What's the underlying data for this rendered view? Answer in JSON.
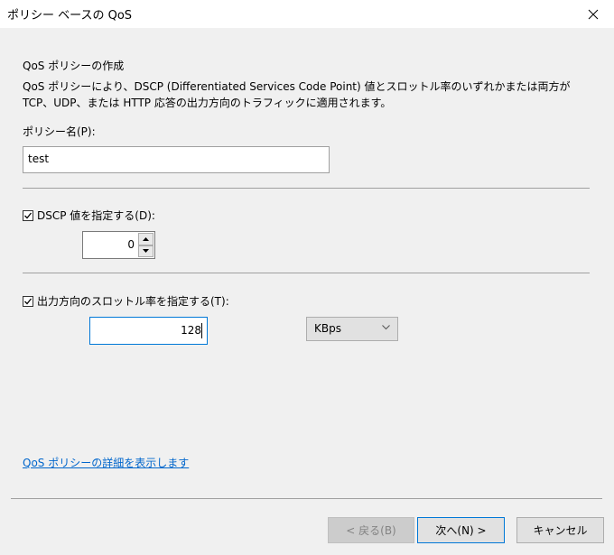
{
  "window": {
    "title": "ポリシー ベースの QoS"
  },
  "page": {
    "heading": "QoS ポリシーの作成",
    "description": "QoS ポリシーにより、DSCP (Differentiated Services Code Point) 値とスロットル率のいずれかまたは両方が TCP、UDP、または HTTP 応答の出力方向のトラフィックに適用されます。",
    "policy_name_label": "ポリシー名(P):",
    "policy_name_value": "test",
    "dscp": {
      "label": "DSCP 値を指定する(D):",
      "checked": true,
      "value": "0"
    },
    "throttle": {
      "label": "出力方向のスロットル率を指定する(T):",
      "checked": true,
      "value": "128",
      "unit": "KBps"
    },
    "details_link": "QoS ポリシーの詳細を表示します"
  },
  "buttons": {
    "back": "< 戻る(B)",
    "next": "次へ(N) >",
    "cancel": "キャンセル"
  },
  "icons": {
    "close": "close-icon",
    "checkbox": "checkmark-icon",
    "spin_up": "arrow-up-icon",
    "spin_down": "arrow-down-icon",
    "dropdown": "chevron-down-icon"
  }
}
